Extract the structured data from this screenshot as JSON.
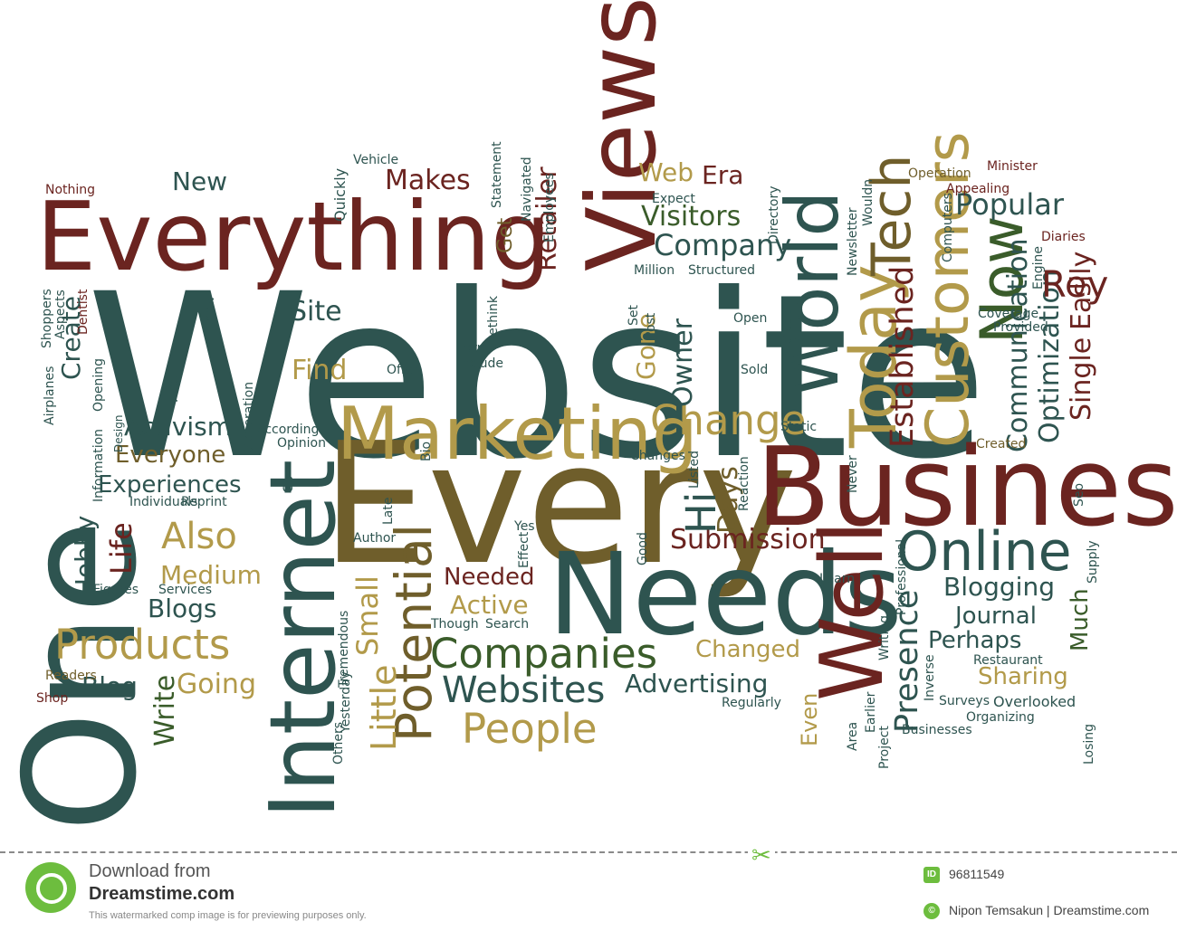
{
  "palette": {
    "teal": "#2e5450",
    "maroon": "#6b2420",
    "olive": "#b29a4a",
    "darkolive": "#6f5e2b",
    "green": "#3a5c2a",
    "brown": "#5a3a1f"
  },
  "word_cloud": {
    "words": [
      "Website",
      "Every",
      "Business",
      "One",
      "Internet",
      "Needs",
      "Everything",
      "Views",
      "Marketing",
      "World",
      "Today",
      "Well",
      "Customers",
      "Now",
      "Online",
      "Tech",
      "Established",
      "Companies",
      "Potential",
      "Products",
      "Change",
      "Presence",
      "Websites",
      "People",
      "Communication",
      "Optimization",
      "Submission",
      "Rey",
      "Popular",
      "Company",
      "Visitors",
      "Web",
      "Era",
      "Retailer",
      "Makes",
      "New",
      "Site",
      "Find",
      "Owner",
      "Gone",
      "Hi",
      "Days",
      "Single",
      "Easily",
      "Activism",
      "Experiences",
      "Everyone",
      "Create",
      "Hobby",
      "Life",
      "Also",
      "Medium",
      "Blogs",
      "Blog",
      "Going",
      "Write",
      "Little",
      "Small",
      "Needed",
      "Active",
      "Advertising",
      "Changed",
      "Blogging",
      "Journal",
      "Perhaps",
      "Much",
      "Sharing",
      "Even",
      "Get",
      "Statement",
      "Navigated",
      "Employees",
      "Quickly",
      "Vehicle",
      "Nothing",
      "Shoppers",
      "Aspects",
      "Dentist",
      "Show",
      "Airplanes",
      "Opening",
      "Information",
      "Design",
      "Free",
      "Generation",
      "According",
      "Opinion",
      "Go",
      "Reprint",
      "Individuals",
      "Services",
      "Figures",
      "Readers",
      "Shop",
      "Late",
      "Bio",
      "Author",
      "Yes",
      "Effect",
      "Good",
      "Though",
      "Search",
      "Tremendous",
      "Yesterday",
      "Others",
      "Rethink",
      "Post",
      "Set",
      "Form",
      "Include",
      "Offer",
      "Expect",
      "Directory",
      "Million",
      "Structured",
      "Open",
      "Available",
      "Sold",
      "Static",
      "Listed",
      "Changes",
      "Reaction",
      "Never",
      "Learn",
      "Professional",
      "Writing",
      "Inverse",
      "Area",
      "Earlier",
      "Project",
      "Restaurant",
      "Regularly",
      "Surveys",
      "Overlooked",
      "Organizing",
      "Businesses",
      "Losing",
      "Seo",
      "Supply",
      "Created",
      "Operation",
      "Appealing",
      "Minister",
      "Coverage",
      "Provided",
      "Diaries",
      "Computers",
      "Wouldn",
      "Newsletter",
      "Engine"
    ]
  },
  "watermark": {
    "download_from": "Download from",
    "brand": "Dreamstime.com",
    "note": "This watermarked comp image is for previewing purposes only.",
    "id_badge": "ID",
    "id": "96811549",
    "copyright_badge": "©",
    "credit": "Nipon Temsakun | Dreamstime.com"
  }
}
